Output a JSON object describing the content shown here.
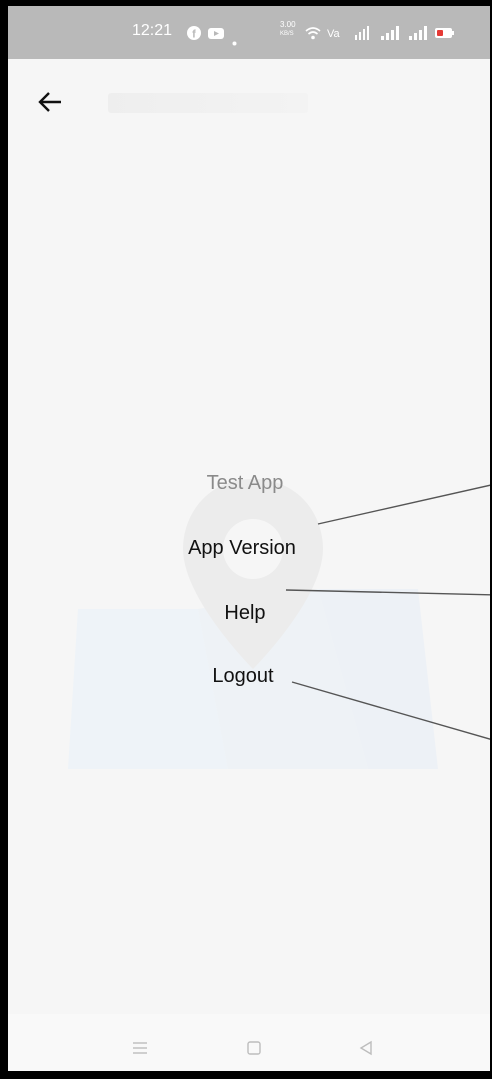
{
  "status_bar": {
    "time": "12:21",
    "icons": [
      "facebook-icon",
      "youtube-icon",
      "dot-icon",
      "speed-icon",
      "wifi-icon",
      "volte-icon",
      "signal-icon",
      "signal-icon",
      "signal-icon",
      "battery-icon"
    ],
    "speed_text": "3.00"
  },
  "app_bar": {
    "back_icon": "arrow-left-icon"
  },
  "menu": {
    "app_name": "Test App",
    "items": [
      {
        "label": "App Version"
      },
      {
        "label": "Help"
      },
      {
        "label": "Logout"
      }
    ]
  },
  "nav_bar": {
    "icons": [
      "menu-icon",
      "home-square-icon",
      "back-triangle-icon"
    ]
  },
  "colors": {
    "status_bar_bg": "#b9b9b9",
    "background": "#f6f6f6",
    "text_primary": "#111111",
    "text_muted": "#8a8a8a"
  }
}
